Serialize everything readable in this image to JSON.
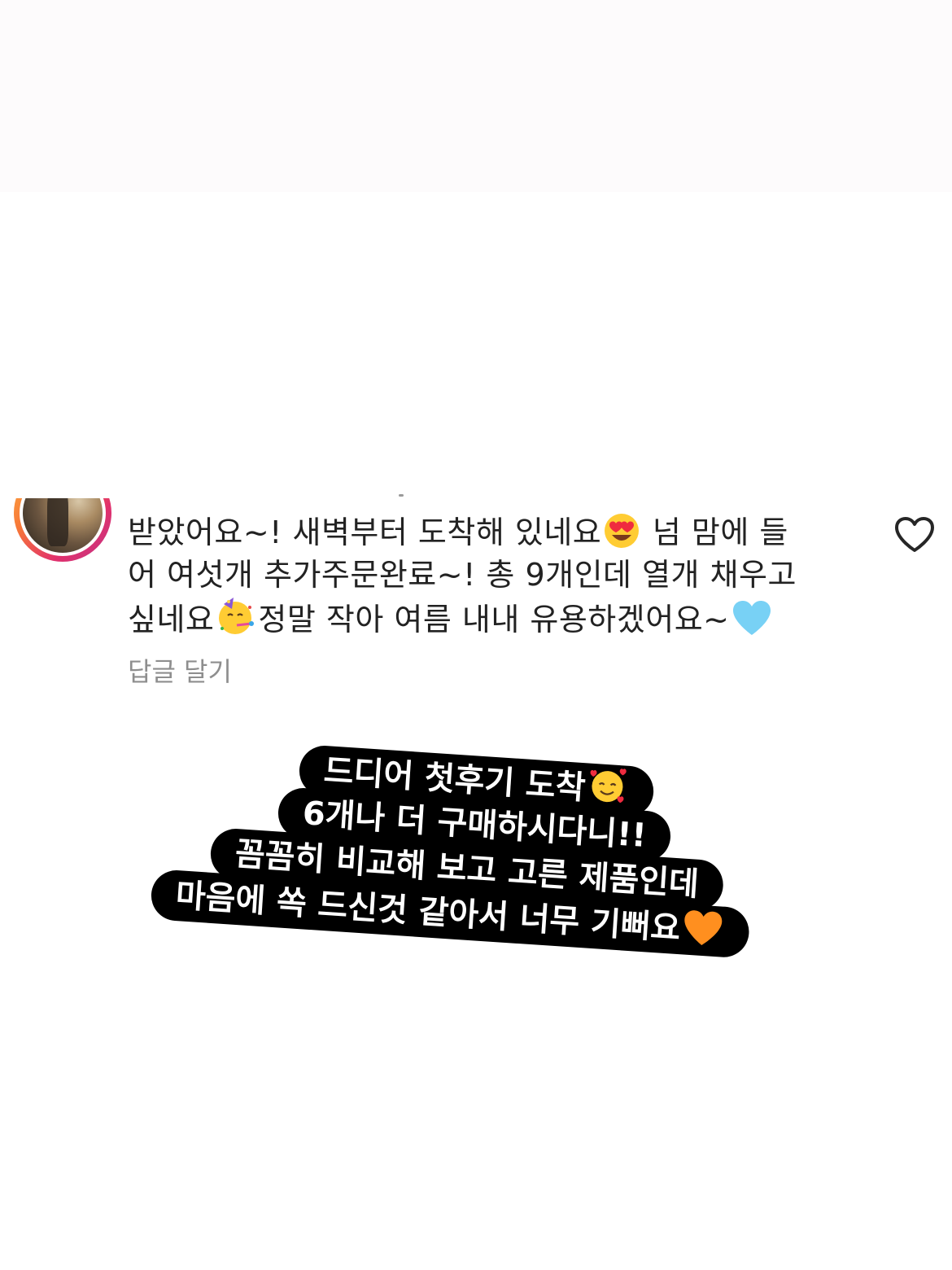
{
  "comment": {
    "lines": [
      "받았어요~! 새벽부터 도착해 있네요",
      " 넘 맘에 들",
      "어 여섯개 추가주문완료~! 총 9개인데 열개 채우고",
      "싶네요",
      "정말 작아 여름 내내 유용하겠어요~"
    ],
    "reply_label": "답글 달기"
  },
  "icons": {
    "like": "heart-outline-icon",
    "avatar": "profile-photo",
    "emoji_1": "heart-eyes-emoji",
    "emoji_2": "partying-face-emoji",
    "emoji_3": "light-blue-heart-emoji",
    "emoji_4": "smiling-face-with-hearts-emoji",
    "emoji_5": "orange-heart-emoji"
  },
  "sticker": {
    "lines": [
      "드디어 첫후기 도착",
      "6개나 더 구매하시다니!!",
      "꼼꼼히 비교해 보고 고른 제품인데",
      "마음에 쏙 드신것 같아서  너무 기뻐요"
    ]
  },
  "colors": {
    "background": "#ffffff",
    "top_band": "#fdfbfc",
    "comment_text": "#222222",
    "reply_text": "#8e8e8e",
    "sticker_bg": "#000000",
    "sticker_text": "#ffffff"
  }
}
